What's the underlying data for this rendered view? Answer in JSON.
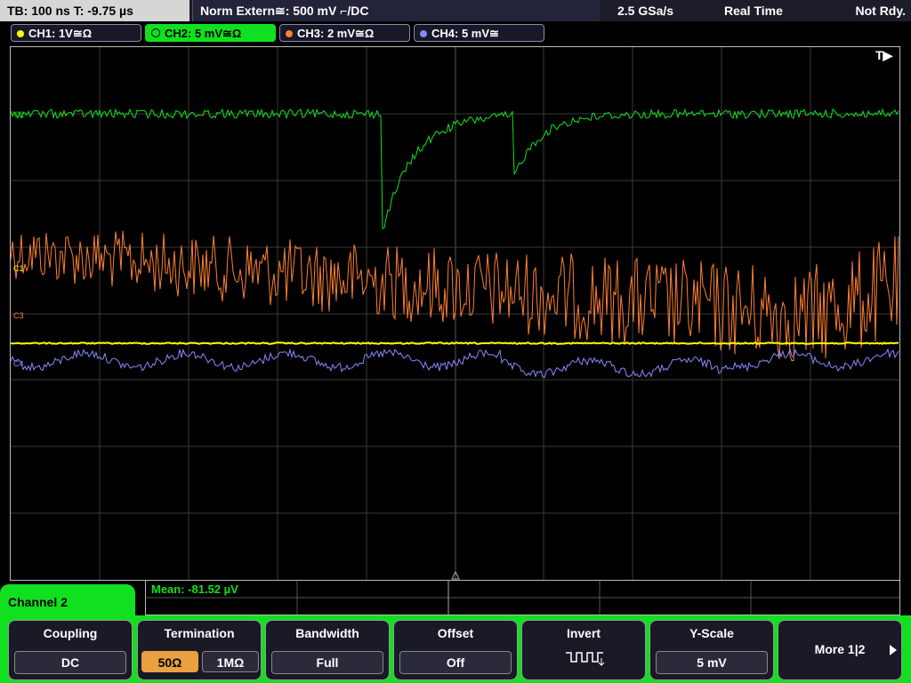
{
  "status_bar": {
    "timebase": "TB: 100 ns   T: -9.75 µs",
    "trigger": "Norm    Extern≅: 500 mV ⌐/DC",
    "sample_rate": "2.5 GSa/s",
    "acquisition": "Real Time",
    "status": "Not Rdy."
  },
  "channels": [
    {
      "label": "CH1: 1V≅Ω",
      "color": "#ffff00"
    },
    {
      "label": "CH2: 5 mV≅Ω",
      "color": "#10e020"
    },
    {
      "label": "CH3: 2 mV≅Ω",
      "color": "#ff8030"
    },
    {
      "label": "CH4: 5 mV≅",
      "color": "#8888ff"
    }
  ],
  "trigger_marker": "T▶",
  "markers": {
    "c1": "C1",
    "c3": "C3",
    "c4": "C4",
    "c2": "C2"
  },
  "measurement": "Mean: -81.52 µV",
  "panel_title": "Channel 2",
  "softkeys": {
    "coupling": {
      "title": "Coupling",
      "value": "DC"
    },
    "termination": {
      "title": "Termination",
      "opt1": "50Ω",
      "opt2": "1MΩ",
      "selected": "50Ω"
    },
    "bandwidth": {
      "title": "Bandwidth",
      "value": "Full"
    },
    "offset": {
      "title": "Offset",
      "value": "Off"
    },
    "invert": {
      "title": "Invert",
      "icon": "invert-waveform-icon"
    },
    "yscale": {
      "title": "Y-Scale",
      "value": "5 mV"
    },
    "more": {
      "label": "More 1|2"
    }
  }
}
